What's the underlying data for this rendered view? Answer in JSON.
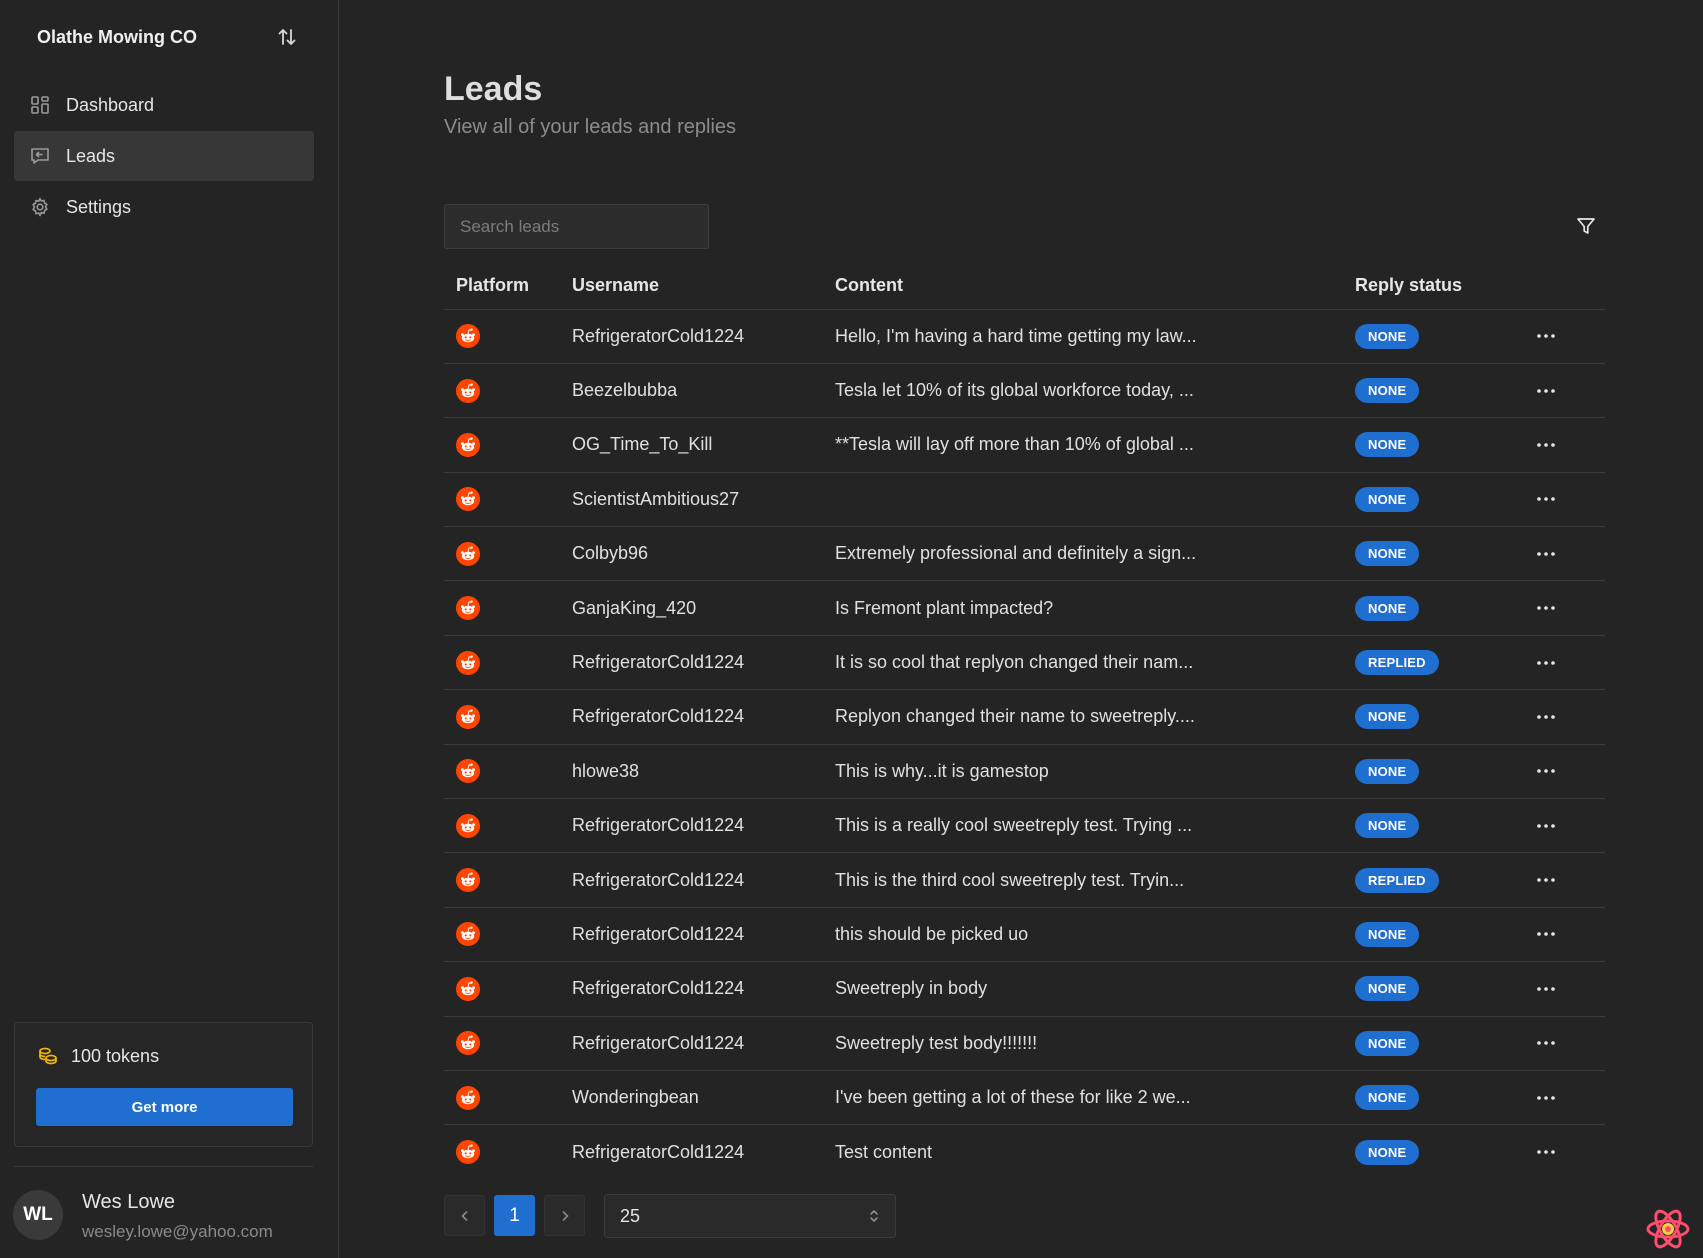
{
  "sidebar": {
    "brand": "Olathe Mowing CO",
    "nav": [
      {
        "label": "Dashboard",
        "icon": "dashboard-icon"
      },
      {
        "label": "Leads",
        "icon": "leads-icon",
        "active": true
      },
      {
        "label": "Settings",
        "icon": "gear-icon"
      }
    ],
    "tokens": {
      "label": "100 tokens",
      "button": "Get more"
    },
    "user": {
      "initials": "WL",
      "name": "Wes Lowe",
      "email": "wesley.lowe@yahoo.com"
    }
  },
  "header": {
    "title": "Leads",
    "subtitle": "View all of your leads and replies"
  },
  "search": {
    "placeholder": "Search leads"
  },
  "table": {
    "columns": [
      "Platform",
      "Username",
      "Content",
      "Reply status"
    ],
    "rows": [
      {
        "username": "RefrigeratorCold1224",
        "content": "Hello, I'm having a hard time getting my law...",
        "status": "NONE"
      },
      {
        "username": "Beezelbubba",
        "content": "Tesla let 10% of its global workforce today, ...",
        "status": "NONE"
      },
      {
        "username": "OG_Time_To_Kill",
        "content": "**Tesla will lay off more than 10% of global ...",
        "status": "NONE"
      },
      {
        "username": "ScientistAmbitious27",
        "content": "",
        "status": "NONE"
      },
      {
        "username": "Colbyb96",
        "content": "Extremely professional and definitely a sign...",
        "status": "NONE"
      },
      {
        "username": "GanjaKing_420",
        "content": "Is Fremont plant impacted?",
        "status": "NONE"
      },
      {
        "username": "RefrigeratorCold1224",
        "content": "It is so cool that replyon changed their nam...",
        "status": "REPLIED"
      },
      {
        "username": "RefrigeratorCold1224",
        "content": "Replyon changed their name to sweetreply....",
        "status": "NONE"
      },
      {
        "username": "hlowe38",
        "content": "This is why...it is gamestop",
        "status": "NONE"
      },
      {
        "username": "RefrigeratorCold1224",
        "content": "This is a really cool sweetreply test. Trying ...",
        "status": "NONE"
      },
      {
        "username": "RefrigeratorCold1224",
        "content": "This is the third cool sweetreply test. Tryin...",
        "status": "REPLIED"
      },
      {
        "username": "RefrigeratorCold1224",
        "content": "this should be picked uo",
        "status": "NONE"
      },
      {
        "username": "RefrigeratorCold1224",
        "content": "Sweetreply in body",
        "status": "NONE"
      },
      {
        "username": "RefrigeratorCold1224",
        "content": "Sweetreply test body!!!!!!!",
        "status": "NONE"
      },
      {
        "username": "Wonderingbean",
        "content": "I've been getting a lot of these for like 2 we...",
        "status": "NONE"
      },
      {
        "username": "RefrigeratorCold1224",
        "content": "Test content",
        "status": "NONE"
      }
    ]
  },
  "pagination": {
    "current_page": "1",
    "per_page": "25"
  },
  "colors": {
    "accent": "#1f6fd1",
    "reddit": "#ff4500",
    "background": "#242424"
  }
}
